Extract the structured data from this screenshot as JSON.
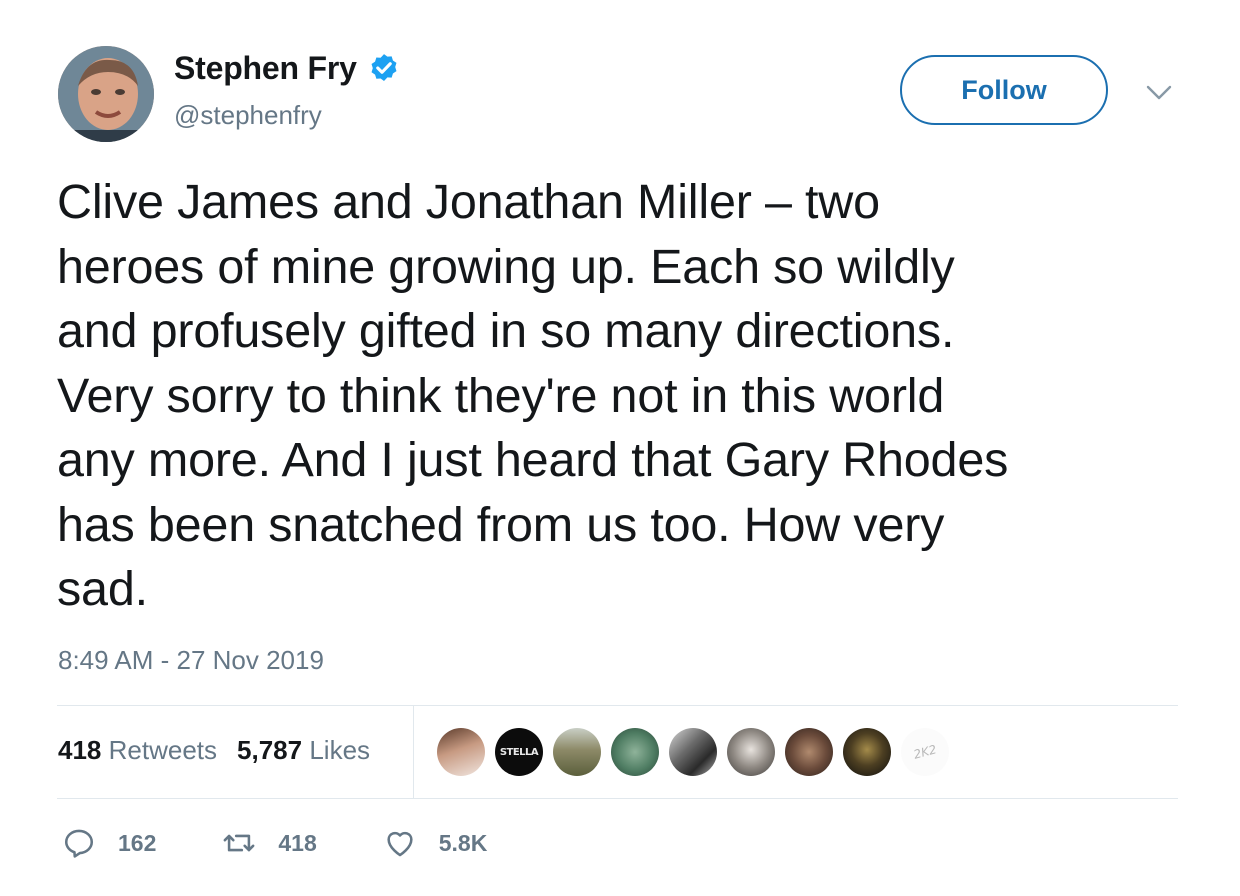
{
  "user": {
    "display_name": "Stephen Fry",
    "handle": "@stephenfry",
    "verified": true
  },
  "follow_label": "Follow",
  "tweet": {
    "text": "Clive James and Jonathan Miller – two\nheroes of mine growing up. Each so wildly\nand profusely gifted in so many directions.\nVery sorry to think they're not in this world\nany more. And I just heard that Gary Rhodes\nhas been snatched from us too. How very\nsad.",
    "timestamp": "8:49 AM - 27 Nov 2019"
  },
  "stats": {
    "retweets_count": "418",
    "retweets_label": "Retweets",
    "likes_count": "5,787",
    "likes_label": "Likes"
  },
  "liker_avatars": [
    {
      "badge": ""
    },
    {
      "badge": "STELLA"
    },
    {
      "badge": ""
    },
    {
      "badge": ""
    },
    {
      "badge": ""
    },
    {
      "badge": ""
    },
    {
      "badge": ""
    },
    {
      "badge": ""
    },
    {
      "badge": "2K2"
    }
  ],
  "actions": {
    "reply_count": "162",
    "retweet_count": "418",
    "like_count": "5.8K"
  },
  "colors": {
    "accent": "#1b6fb0",
    "verified": "#1da1f2",
    "secondary_text": "#657786",
    "primary_text": "#14171a"
  },
  "icons": [
    "verified-badge-icon",
    "chevron-down-icon",
    "reply-icon",
    "retweet-icon",
    "heart-icon"
  ]
}
